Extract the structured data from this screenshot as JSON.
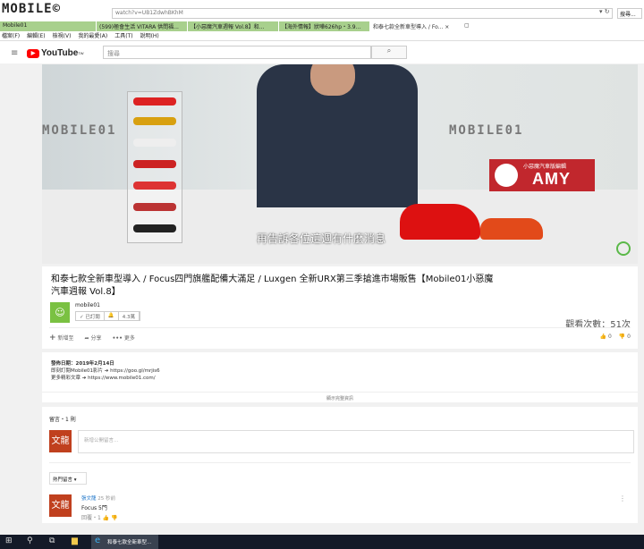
{
  "browser": {
    "logo": "MOBILE01",
    "url": "watch?v=UB1ZdwhBKhM",
    "search": "搜尋...",
    "tabs": [
      "Mobile01",
      "(599)極會生活 VITARA 供問福...",
      "【小惡魔汽車週報 Vol.8】和...",
      "【海外情報】狀嘩626hp・3.9...",
      "和泰七款全新車型導入 / Fo... ×"
    ],
    "menu": [
      "檔案(F)",
      "編輯(E)",
      "檢視(V)",
      "我的最愛(A)",
      "工具(T)",
      "說明(H)"
    ]
  },
  "youtube": {
    "logo": "YouTube",
    "region": "TW",
    "search_placeholder": "搜尋"
  },
  "video": {
    "subtitle": "再告訴各位這週有什麼消息",
    "badge_title": "小惡魔汽車版編輯",
    "badge_name": "AMY",
    "watermark": "MOBILE01"
  },
  "info": {
    "title": "和泰七款全新車型導入 / Focus四門旗艦配備大滿足 / Luxgen 全新URX第三季搶進市場販售【Mobile01小惡魔汽車週報 Vol.8】",
    "channel": "mobile01",
    "subscribed": "已訂閱",
    "sub_count": "4.3萬",
    "views": "觀看次數：51次",
    "add": "新增至",
    "share": "分享",
    "more": "更多",
    "likes": "0",
    "dislikes": "0"
  },
  "description": {
    "date": "發佈日期：2019年2月14日",
    "line1": "即刻訂閱Mobile01影片 ➔ https://goo.gl/mrjis6",
    "line2": "更多精彩文章 ➔ https://www.mobile01.com/",
    "show_more": "顯示完整資訊"
  },
  "comments": {
    "count": "留言・1 則",
    "avatar": "文龍",
    "placeholder": "新增公開留言...",
    "sort": "熱門留言 ▾",
    "items": [
      {
        "author": "張文龍",
        "time": "25 秒前",
        "text": "Focus 5門",
        "reply": "回覆・1"
      }
    ]
  },
  "taskbar": {
    "app": "和泰七款全新車型..."
  }
}
